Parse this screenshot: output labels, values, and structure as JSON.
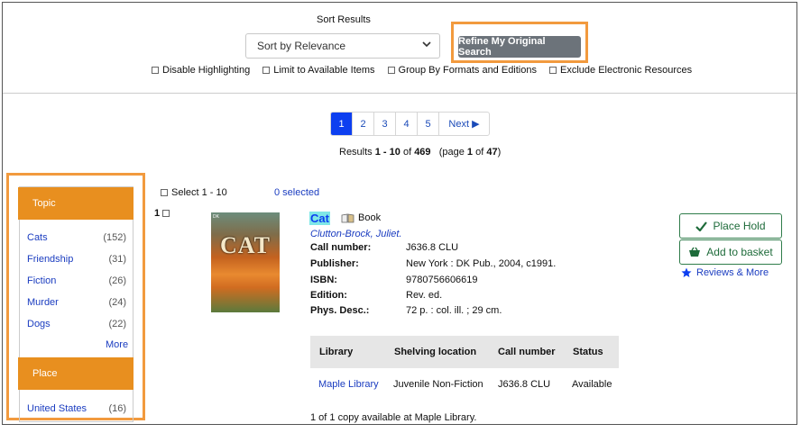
{
  "sort": {
    "title": "Sort Results",
    "selected": "Sort by Relevance",
    "refine_label": "Refine My Original Search"
  },
  "filters": [
    {
      "label": "Disable Highlighting"
    },
    {
      "label": "Limit to Available Items"
    },
    {
      "label": "Group By Formats and Editions"
    },
    {
      "label": "Exclude Electronic Resources"
    }
  ],
  "pager": {
    "pages": [
      "1",
      "2",
      "3",
      "4",
      "5"
    ],
    "active": "1",
    "next_label": "Next ▶"
  },
  "results_summary": {
    "prefix": "Results ",
    "range": "1 - 10",
    "of": " of ",
    "total": "469",
    "page_prefix": "   (page ",
    "page": "1",
    "page_of": " of ",
    "pages": "47",
    "suffix": ")"
  },
  "facets": {
    "topic_header": "Topic",
    "topic_items": [
      {
        "label": "Cats",
        "count": "(152)"
      },
      {
        "label": "Friendship",
        "count": "(31)"
      },
      {
        "label": "Fiction",
        "count": "(26)"
      },
      {
        "label": "Murder",
        "count": "(24)"
      },
      {
        "label": "Dogs",
        "count": "(22)"
      }
    ],
    "more_label": "More",
    "place_header": "Place",
    "place_items": [
      {
        "label": "United States",
        "count": "(16)"
      }
    ]
  },
  "selection": {
    "select_label": "Select 1 - 10",
    "selected_label": "0 selected"
  },
  "record": {
    "number": "1",
    "title": "Cat",
    "format": "Book",
    "cover_text": "CAT",
    "author": "Clutton-Brock, Juliet.",
    "fields": [
      {
        "label": "Call number:",
        "value": "J636.8 CLU"
      },
      {
        "label": "Publisher:",
        "value": "New York : DK Pub., 2004, c1991."
      },
      {
        "label": "ISBN:",
        "value": "9780756606619"
      },
      {
        "label": "Edition:",
        "value": "Rev. ed."
      },
      {
        "label": "Phys. Desc.:",
        "value": "72 p. : col. ill. ; 29 cm."
      }
    ],
    "holdings": {
      "headers": [
        "Library",
        "Shelving location",
        "Call number",
        "Status"
      ],
      "rows": [
        {
          "library": "Maple Library",
          "location": "Juvenile Non-Fiction",
          "call": "J636.8 CLU",
          "status": "Available"
        }
      ]
    },
    "availability": "1 of 1 copy available at Maple Library."
  },
  "actions": {
    "place_hold": "Place Hold",
    "add_basket": "Add to basket",
    "reviews": "Reviews & More"
  },
  "colors": {
    "accent_orange": "#f29a3e",
    "facet_header": "#e88f1f",
    "link_blue": "#1a3cc0",
    "active_page": "#0d3ff0",
    "action_green": "#2f7c4a"
  }
}
